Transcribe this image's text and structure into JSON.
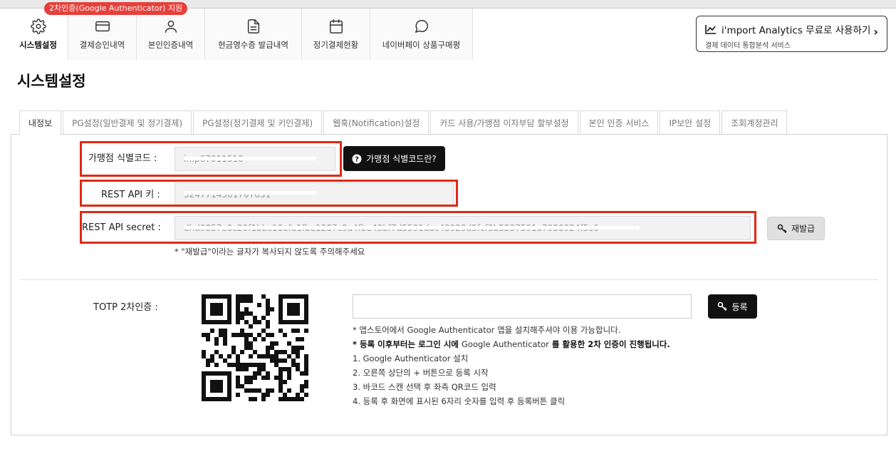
{
  "nav": {
    "badge": "2차인증(Google Authenticator) 지원",
    "items": [
      {
        "label": "시스템설정",
        "icon": "gear-icon"
      },
      {
        "label": "결제승인내역",
        "icon": "card-icon"
      },
      {
        "label": "본인인증내역",
        "icon": "user-icon"
      },
      {
        "label": "현금영수증 발급내역",
        "icon": "receipt-icon"
      },
      {
        "label": "정기결제현황",
        "icon": "calendar-icon"
      },
      {
        "label": "네이버페이 상품구매평",
        "icon": "chat-bubble-icon"
      }
    ]
  },
  "promo": {
    "title": "i'mport Analytics 무료로 사용하기",
    "subtitle": "결제 데이터 통합분석 서비스",
    "icon": "chart-line-icon"
  },
  "page_title": "시스템설정",
  "tabs": [
    "내정보",
    "PG설정(일반결제 및 정기결제)",
    "PG설정(정기결제 및 키인결제)",
    "웹훅(Notification)설정",
    "카드 사용/가맹점 이자부담 할부설정",
    "본인 인증 서비스",
    "IP보안 설정",
    "조회계정관리"
  ],
  "account": {
    "merchant_code_label": "가맹점 식별코드 :",
    "merchant_code_value": "imp67011510",
    "merchant_help_button": "가맹점 식별코드란?",
    "api_key_label": "REST API 키 :",
    "api_key_value": "5247714501707651",
    "api_secret_label": "REST API secret :",
    "api_secret_value": "dhd9857e0c20f1bbc10efa1fbe1287c9a4fbe43bf7d5591dac43929d5fcf3b5237591a7980924f5c6",
    "reissue_button": "재발급",
    "reissue_note": "* \"재발급\"이라는 글자가 복사되지 않도록 주의해주세요"
  },
  "otp": {
    "label": "TOTP 2차인증 :",
    "input_value": "",
    "register_button": "등록",
    "guide": {
      "line1": "* 앱스토어에서 Google Authenticator 앱을 설치해주셔야 이용 가능합니다.",
      "line2_a": "* 등록 이후부터는 로그인 시에 ",
      "line2_b": "Google Authenticator",
      "line2_c": " 를 활용한 2차 인증이 진행됩니다.",
      "step1": "1. Google Authenticator 설치",
      "step2": "2. 오른쪽 상단의 + 버튼으로 등록 시작",
      "step3": "3. 바코드 스캔 선택 후 좌측 QR코드 입력",
      "step4": "4. 등록 후 화면에 표시된 6자리 숫자를 입력 후 등록버튼 클릭"
    }
  },
  "colors": {
    "highlight": "#e02914",
    "badge": "#e5403b",
    "button_dark": "#111111"
  }
}
